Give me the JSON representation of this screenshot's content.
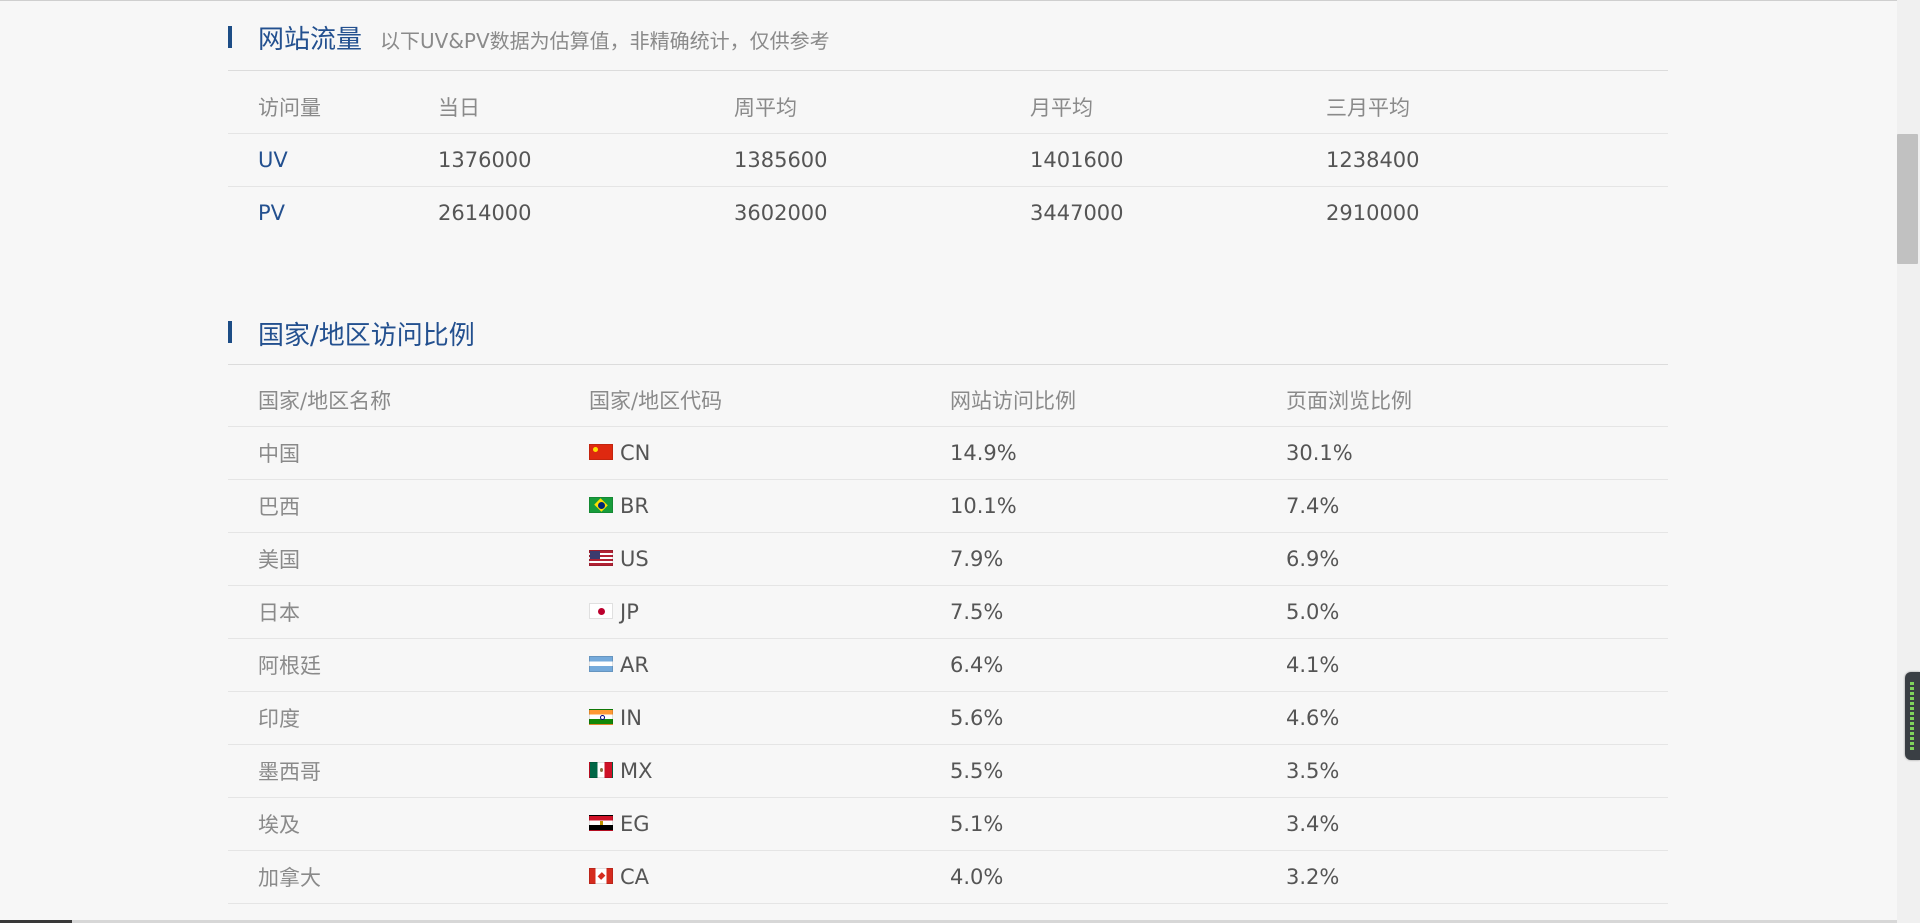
{
  "traffic": {
    "title": "网站流量",
    "subtitle": "以下UV&PV数据为估算值，非精确统计，仅供参考",
    "columns": [
      "访问量",
      "当日",
      "周平均",
      "月平均",
      "三月平均"
    ],
    "rows": [
      {
        "label": "UV",
        "today": "1376000",
        "week_avg": "1385600",
        "month_avg": "1401600",
        "three_month_avg": "1238400"
      },
      {
        "label": "PV",
        "today": "2614000",
        "week_avg": "3602000",
        "month_avg": "3447000",
        "three_month_avg": "2910000"
      }
    ]
  },
  "regions": {
    "title": "国家/地区访问比例",
    "columns": [
      "国家/地区名称",
      "国家/地区代码",
      "网站访问比例",
      "页面浏览比例"
    ],
    "rows": [
      {
        "name": "中国",
        "code": "CN",
        "flag_icon": "flag-china-icon",
        "visit_ratio": "14.9%",
        "pageview_ratio": "30.1%"
      },
      {
        "name": "巴西",
        "code": "BR",
        "flag_icon": "flag-brazil-icon",
        "visit_ratio": "10.1%",
        "pageview_ratio": "7.4%"
      },
      {
        "name": "美国",
        "code": "US",
        "flag_icon": "flag-usa-icon",
        "visit_ratio": "7.9%",
        "pageview_ratio": "6.9%"
      },
      {
        "name": "日本",
        "code": "JP",
        "flag_icon": "flag-japan-icon",
        "visit_ratio": "7.5%",
        "pageview_ratio": "5.0%"
      },
      {
        "name": "阿根廷",
        "code": "AR",
        "flag_icon": "flag-argentina-icon",
        "visit_ratio": "6.4%",
        "pageview_ratio": "4.1%"
      },
      {
        "name": "印度",
        "code": "IN",
        "flag_icon": "flag-india-icon",
        "visit_ratio": "5.6%",
        "pageview_ratio": "4.6%"
      },
      {
        "name": "墨西哥",
        "code": "MX",
        "flag_icon": "flag-mexico-icon",
        "visit_ratio": "5.5%",
        "pageview_ratio": "3.5%"
      },
      {
        "name": "埃及",
        "code": "EG",
        "flag_icon": "flag-egypt-icon",
        "visit_ratio": "5.1%",
        "pageview_ratio": "3.4%"
      },
      {
        "name": "加拿大",
        "code": "CA",
        "flag_icon": "flag-canada-icon",
        "visit_ratio": "4.0%",
        "pageview_ratio": "3.2%"
      }
    ]
  },
  "colors": {
    "accent": "#23508f",
    "section_bar": "#1d4d86",
    "background": "#f7f7f7",
    "muted_text": "#8a8a8a"
  }
}
